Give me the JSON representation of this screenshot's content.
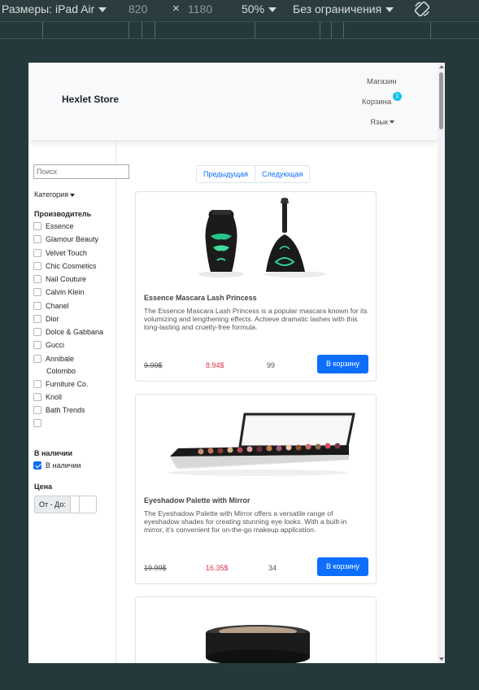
{
  "devtools": {
    "device_label": "Размеры: iPad Air",
    "width": "820",
    "times": "×",
    "height": "1180",
    "zoom": "50%",
    "throttle": "Без ограничения"
  },
  "navbar": {
    "brand": "Hexlet Store",
    "links": {
      "shop": "Магазин",
      "cart": "Корзина",
      "lang": "Язык"
    },
    "cart_badge": "1"
  },
  "sidebar": {
    "search_placeholder": "Поиск",
    "category_label": "Категория",
    "manufacturers_title": "Производитель",
    "manufacturers": [
      "Essence",
      "Glamour Beauty",
      "Velvet Touch",
      "Chic Cosmetics",
      "Nail Couture",
      "Calvin Klein",
      "Chanel",
      "Dior",
      "Dolce & Gabbana",
      "Gucci",
      "Annibale",
      "Colombo",
      "Furniture Co.",
      "Knoll",
      "Bath Trends",
      ""
    ],
    "in_stock_title": "В наличии",
    "in_stock_label": "В наличии",
    "in_stock_checked": true,
    "price_title": "Цена",
    "price_label": "От - До:"
  },
  "pagination": {
    "prev": "Предыдущая",
    "next": "Следующая"
  },
  "products": [
    {
      "title": "Essence Mascara Lash Princess",
      "description": "The Essence Mascara Lash Princess is a popular mascara known for its volumizing and lengthening effects. Achieve dramatic lashes with this long-lasting and cruelty-free formula.",
      "old_price": "9.99$",
      "new_price": "8.94$",
      "stock": "99",
      "button": "В корзину"
    },
    {
      "title": "Eyeshadow Palette with Mirror",
      "description": "The Eyeshadow Palette with Mirror offers a versatile range of eyeshadow shades for creating stunning eye looks. With a built-in mirror, it's convenient for on-the-go makeup application.",
      "old_price": "19.99$",
      "new_price": "16.35$",
      "stock": "34",
      "button": "В корзину"
    }
  ],
  "colors": {
    "primary": "#0d6efd",
    "price_new": "#dc3545",
    "badge": "#17c1e8",
    "devtools_bg": "#25393c"
  }
}
